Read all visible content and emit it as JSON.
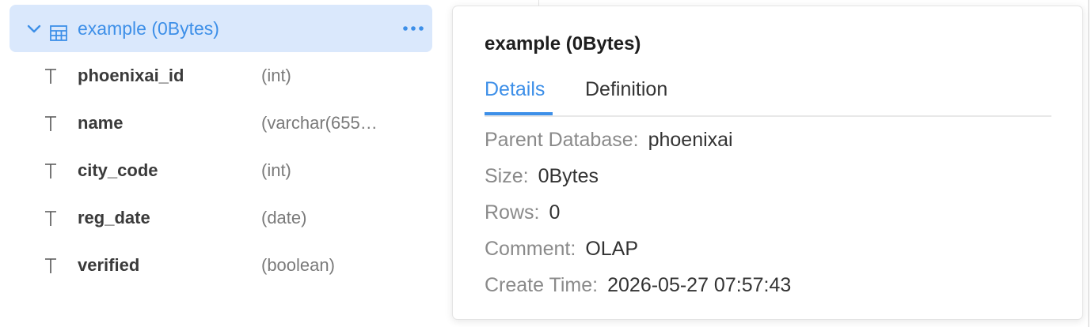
{
  "tree": {
    "table": {
      "label": "example (0Bytes)",
      "expand_icon": "chevron-down-icon",
      "type_icon": "table-icon",
      "more_icon": "more-horizontal-icon"
    },
    "columns": [
      {
        "name": "phoenixai_id",
        "type": "(int)",
        "icon": "text-type-icon"
      },
      {
        "name": "name",
        "type": "(varchar(655…",
        "icon": "text-type-icon"
      },
      {
        "name": "city_code",
        "type": "(int)",
        "icon": "text-type-icon"
      },
      {
        "name": "reg_date",
        "type": "(date)",
        "icon": "text-type-icon"
      },
      {
        "name": "verified",
        "type": "(boolean)",
        "icon": "text-type-icon"
      }
    ]
  },
  "popover": {
    "title": "example (0Bytes)",
    "tabs": [
      {
        "label": "Details",
        "active": true
      },
      {
        "label": "Definition",
        "active": false
      }
    ],
    "details": [
      {
        "label": "Parent Database:",
        "value": "phoenixai"
      },
      {
        "label": "Size:",
        "value": "0Bytes"
      },
      {
        "label": "Rows:",
        "value": "0"
      },
      {
        "label": "Comment:",
        "value": "OLAP"
      },
      {
        "label": "Create Time:",
        "value": "2026-05-27 07:57:43"
      }
    ]
  },
  "colors": {
    "accent": "#3d8fe8",
    "selected_row_bg": "#dae8fc",
    "label_gray": "#8a8a8a",
    "value_dark": "#333333",
    "type_gray": "#7a7a7a"
  }
}
